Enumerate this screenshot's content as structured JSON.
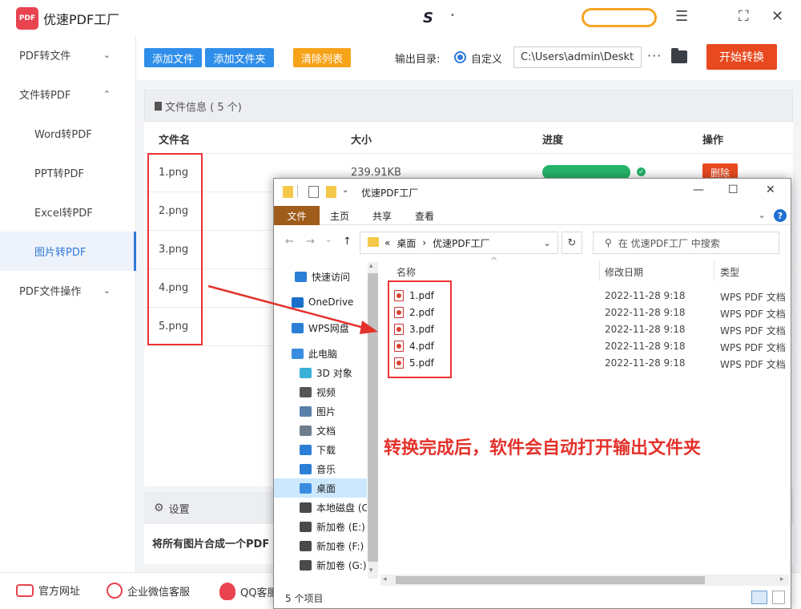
{
  "app": {
    "title": "优速PDF工厂",
    "logo_text": "PDF",
    "title_mid_logo": "S",
    "title_mid_dot": "•"
  },
  "window_controls": {
    "menu": "☰",
    "maximize": "⛶",
    "close": "✕"
  },
  "sidebar": {
    "items": [
      {
        "label": "PDF转文件",
        "chevron": "⌄"
      },
      {
        "label": "文件转PDF",
        "chevron": "⌃"
      },
      {
        "label": "Word转PDF"
      },
      {
        "label": "PPT转PDF"
      },
      {
        "label": "Excel转PDF"
      },
      {
        "label": "图片转PDF"
      },
      {
        "label": "PDF文件操作",
        "chevron": "⌄"
      }
    ]
  },
  "toolbar": {
    "add_file": "添加文件",
    "add_folder": "添加文件夹",
    "clear_list": "清除列表",
    "output_label": "输出目录:",
    "radio_label": "自定义",
    "output_path": "C:\\Users\\admin\\Deskto",
    "more": "···",
    "start": "开始转换"
  },
  "file_table": {
    "info_title": "文件信息 ( 5 个)",
    "headers": {
      "name": "文件名",
      "size": "大小",
      "progress": "进度",
      "action": "操作"
    },
    "files": [
      "1.png",
      "2.png",
      "3.png",
      "4.png",
      "5.png"
    ],
    "first_size": "239.91KB",
    "progress": 1.0,
    "check": "✓",
    "delete_label": "删除"
  },
  "settings": {
    "title": "设置",
    "merge_text": "将所有图片合成一个PDF"
  },
  "footer": {
    "website": "官方网址",
    "wechat": "企业微信客服",
    "qq": "QQ客服"
  },
  "explorer": {
    "title": "优速PDF工厂",
    "controls": {
      "minimize": "—",
      "maximize": "☐",
      "close": "✕"
    },
    "tabs": {
      "file": "文件",
      "home": "主页",
      "share": "共享",
      "view": "查看"
    },
    "ribbon_right": {
      "chevron": "⌄",
      "help": "?"
    },
    "nav": {
      "back": "←",
      "forward": "→",
      "dropdown": "⌄",
      "up": "↑"
    },
    "address": {
      "prefix": "«",
      "crumb1": "桌面",
      "sep": "›",
      "crumb2": "优速PDF工厂",
      "chevron": "⌄"
    },
    "refresh": "↻",
    "search_icon": "⚲",
    "search_placeholder": "在 优速PDF工厂 中搜索",
    "nav_pane": [
      {
        "label": "快速访问",
        "color": "#2b7fd6"
      },
      {
        "label": "OneDrive",
        "color": "#1b6fc9"
      },
      {
        "label": "WPS网盘",
        "color": "#2b7fd6"
      },
      {
        "label": "此电脑",
        "color": "#3a8dde"
      },
      {
        "label": "3D 对象",
        "color": "#3ab0d8"
      },
      {
        "label": "视频",
        "color": "#555"
      },
      {
        "label": "图片",
        "color": "#5a7fa8"
      },
      {
        "label": "文档",
        "color": "#6f7d8e"
      },
      {
        "label": "下载",
        "color": "#2b7fd6"
      },
      {
        "label": "音乐",
        "color": "#2b7fd6"
      },
      {
        "label": "桌面",
        "color": "#3a8dde"
      },
      {
        "label": "本地磁盘 (C:)",
        "color": "#4a4a4a"
      },
      {
        "label": "新加卷 (E:)",
        "color": "#4a4a4a"
      },
      {
        "label": "新加卷 (F:)",
        "color": "#4a4a4a"
      },
      {
        "label": "新加卷 (G:)",
        "color": "#4a4a4a"
      }
    ],
    "columns": {
      "name": "名称",
      "date": "修改日期",
      "type": "类型",
      "sort_indicator": "^"
    },
    "files": [
      {
        "name": "1.pdf",
        "date": "2022-11-28 9:18",
        "type": "WPS PDF 文档"
      },
      {
        "name": "2.pdf",
        "date": "2022-11-28 9:18",
        "type": "WPS PDF 文档"
      },
      {
        "name": "3.pdf",
        "date": "2022-11-28 9:18",
        "type": "WPS PDF 文档"
      },
      {
        "name": "4.pdf",
        "date": "2022-11-28 9:18",
        "type": "WPS PDF 文档"
      },
      {
        "name": "5.pdf",
        "date": "2022-11-28 9:18",
        "type": "WPS PDF 文档"
      }
    ],
    "status": "5 个项目",
    "scroll": {
      "up": "▴",
      "down": "▾",
      "left": "◂",
      "right": "▸"
    }
  },
  "annotation": "转换完成后，软件会自动打开输出文件夹",
  "colors": {
    "brand_red": "#e8434f",
    "blue_btn": "#2f8ee9",
    "orange_btn": "#f7a319",
    "start_btn": "#e8491f",
    "progress_green": "#26b36a",
    "annotation_red": "#e4322b",
    "explorer_file_tab": "#a05c1a"
  }
}
